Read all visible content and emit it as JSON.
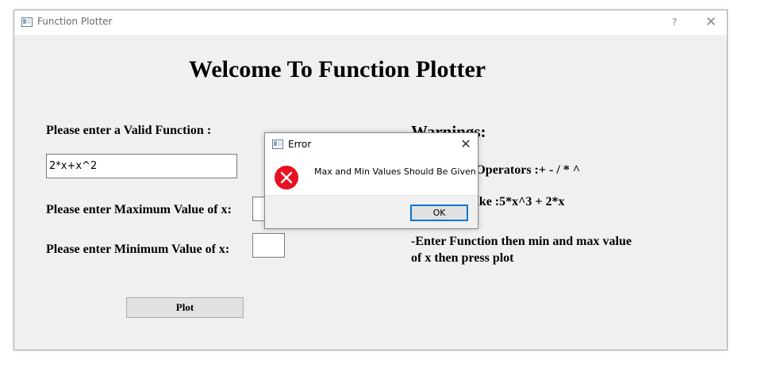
{
  "window": {
    "title": "Function Plotter",
    "help_label": "?",
    "close_label": "✕"
  },
  "main": {
    "heading": "Welcome To Function Plotter",
    "function_label": "Please enter a Valid Function :",
    "function_value": "2*x+x^2",
    "max_label": "Please enter Maximum Value of x:",
    "max_value": "",
    "min_label": "Please enter Minimum Value of x:",
    "min_value": "",
    "plot_label": "Plot"
  },
  "warnings": {
    "title": "Warnings:",
    "line1": "-Supported Operators :+ - / * ^",
    "line2": "-Functions like :5*x^3 + 2*x",
    "line3": "-Enter Function then min and max value",
    "line4": "of x then press plot"
  },
  "dialog": {
    "title": "Error",
    "message": "Max and Min Values Should Be Given",
    "ok_label": "OK",
    "close_label": "✕",
    "icon": "error-icon"
  },
  "colors": {
    "window_bg": "#f0f0f0",
    "error_red": "#e81123",
    "focus_blue": "#0078d7"
  }
}
